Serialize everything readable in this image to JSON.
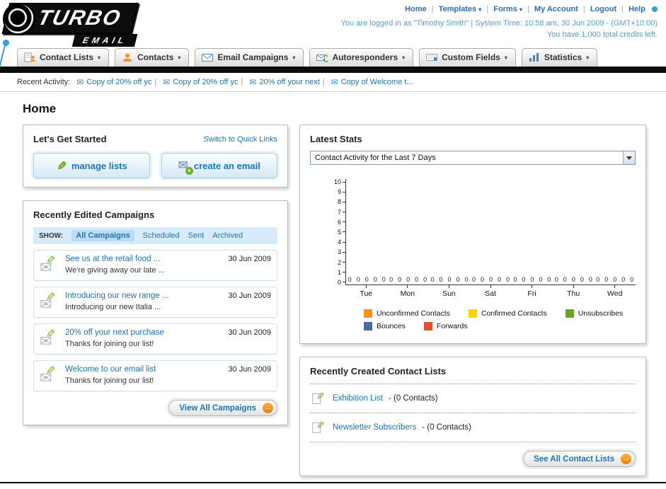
{
  "colors": {
    "link_blue": "#1b75bb",
    "accent_orange": "#f7941d",
    "nav_bar_black": "#0c0c0c",
    "light_blue_text": "#57a0d3"
  },
  "icons": {
    "caret_down": "▾",
    "envelope": "✉",
    "pencil": "✎",
    "plus": "+",
    "arrow_right": "→"
  },
  "logo": {
    "line1": "TURBO",
    "line2": "EMAIL"
  },
  "header": {
    "sep": "|",
    "links": [
      {
        "label": "Home"
      },
      {
        "label": "Templates"
      },
      {
        "label": "Forms"
      },
      {
        "label": "My Account"
      },
      {
        "label": "Logout"
      },
      {
        "label": "Help"
      }
    ],
    "login_line": "You are logged in as \"Timothy Smith\" | System Time: 10:58 am, 30 Jun 2009 - (GMT+10:00)",
    "credits_line": "You have 1,000 total credits left."
  },
  "nav": {
    "items": [
      {
        "label": "Contact Lists"
      },
      {
        "label": "Contacts"
      },
      {
        "label": "Email Campaigns"
      },
      {
        "label": "Autoresponders"
      },
      {
        "label": "Custom Fields"
      },
      {
        "label": "Statistics"
      }
    ]
  },
  "recent_activity": {
    "label": "Recent Activity:",
    "sep": "|",
    "items": [
      "Copy of 20% off yc",
      "Copy of 20% off yc",
      "20% off your next",
      "Copy of Welcome t..."
    ]
  },
  "page_title": "Home",
  "get_started": {
    "title": "Let's Get Started",
    "switch_link": "Switch to Quick Links",
    "manage_lists_label": "manage lists",
    "create_email_label": "create an email"
  },
  "campaigns": {
    "title": "Recently Edited Campaigns",
    "show_label": "SHOW:",
    "tabs": [
      "All Campaigns",
      "Scheduled",
      "Sent",
      "Archived"
    ],
    "items": [
      {
        "title": "See us at the retail food ...",
        "subtitle": "We're giving away our late ...",
        "date": "30 Jun 2009"
      },
      {
        "title": "Introducing our new range ...",
        "subtitle": "Introducing our new Italia ...",
        "date": "30 Jun 2009"
      },
      {
        "title": "20% off your next purchase",
        "subtitle": "Thanks for joining our list!",
        "date": "30 Jun 2009"
      },
      {
        "title": "Welcome to our email list",
        "subtitle": "Thanks for joining our list!",
        "date": "30 Jun 2009"
      }
    ],
    "view_all_label": "View All Campaigns"
  },
  "stats": {
    "title": "Latest Stats",
    "dropdown_value": "Contact Activity for the Last 7 Days",
    "chart_data": {
      "type": "bar",
      "title": "Contact Activity for the Last 7 Days",
      "categories": [
        "Tue",
        "Mon",
        "Sun",
        "Sat",
        "Fri",
        "Thu",
        "Wed"
      ],
      "series": [
        {
          "name": "Unconfirmed Contacts",
          "color": "#f7941d",
          "values": [
            0,
            0,
            0,
            0,
            0,
            0,
            0
          ]
        },
        {
          "name": "Confirmed Contacts",
          "color": "#ffd200",
          "values": [
            0,
            0,
            0,
            0,
            0,
            0,
            0
          ]
        },
        {
          "name": "Unsubscribes",
          "color": "#66a31e",
          "values": [
            0,
            0,
            0,
            0,
            0,
            0,
            0
          ]
        },
        {
          "name": "Bounces",
          "color": "#4a69a5",
          "values": [
            0,
            0,
            0,
            0,
            0,
            0,
            0
          ]
        },
        {
          "name": "Forwards",
          "color": "#e8502a",
          "values": [
            0,
            0,
            0,
            0,
            0,
            0,
            0
          ]
        }
      ],
      "xlabel": "",
      "ylabel": "",
      "ylim": [
        0,
        10
      ],
      "yticks": [
        0,
        1,
        2,
        3,
        4,
        5,
        6,
        7,
        8,
        9,
        10
      ],
      "grid": false,
      "legend_position": "bottom"
    }
  },
  "contact_lists": {
    "title": "Recently Created Contact Lists",
    "items": [
      {
        "name": "Exhibition List",
        "count": "- (0 Contacts)"
      },
      {
        "name": "Newsletter Subscribers",
        "count": "- (0 Contacts)"
      }
    ],
    "see_all_label": "See All Contact Lists"
  }
}
